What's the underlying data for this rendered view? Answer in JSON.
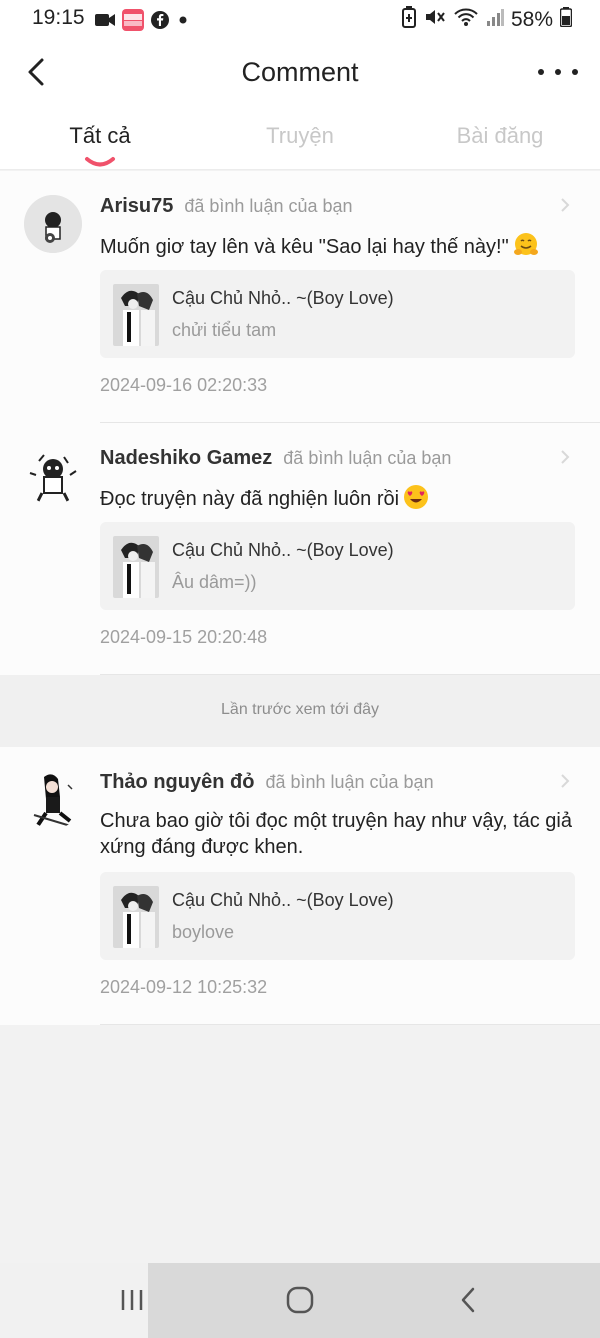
{
  "status_bar": {
    "time": "19:15",
    "battery": "58%",
    "left_icons": [
      "video-icon",
      "mangatoon-app-icon",
      "facebook-icon",
      "dot-icon"
    ],
    "right_icons": [
      "battery-saver-icon",
      "mute-icon",
      "wifi-icon",
      "signal-icon",
      "battery-icon"
    ],
    "app_badge_text": "MANGA TOON"
  },
  "header": {
    "title": "Comment",
    "back_icon": "chevron-left-icon",
    "more_icon": "more-horizontal-icon"
  },
  "tabs": [
    {
      "label": "Tất cả",
      "active": true
    },
    {
      "label": "Truyện",
      "active": false
    },
    {
      "label": "Bài đăng",
      "active": false
    }
  ],
  "comments": [
    {
      "user": "Arisu75",
      "action": "đã bình luận của bạn",
      "text": "Muốn giơ tay lên và kêu \"Sao lại hay thế này!\"",
      "emoji": "hugging-face-emoji",
      "ref": {
        "title": "Cậu Chủ Nhỏ.. ~(Boy Love)",
        "snippet": "chửi tiểu tam"
      },
      "time": "2024-09-16 02:20:33"
    },
    {
      "user": "Nadeshiko Gamez",
      "action": "đã bình luận của bạn",
      "text": "Đọc truyện này đã nghiện luôn rồi",
      "emoji": "heart-eyes-emoji",
      "ref": {
        "title": "Cậu Chủ Nhỏ.. ~(Boy Love)",
        "snippet": "Âu dâm=))"
      },
      "time": "2024-09-15 20:20:48"
    },
    {
      "user": "Thảo nguyên đỏ",
      "action": "đã bình luận của bạn",
      "text": "Chưa bao giờ tôi đọc một truyện hay như vậy, tác giả xứng đáng được khen.",
      "ref": {
        "title": "Cậu Chủ Nhỏ.. ~(Boy Love)",
        "snippet": "boylove"
      },
      "time": "2024-09-12 10:25:32"
    }
  ],
  "last_seen_divider": "Lần trước xem tới đây",
  "nav_bar": {
    "buttons": [
      "recent-apps-icon",
      "home-icon",
      "back-icon"
    ]
  },
  "colors": {
    "accent": "#f0526b",
    "background": "#f2f2f2",
    "card": "#fcfcfc"
  }
}
